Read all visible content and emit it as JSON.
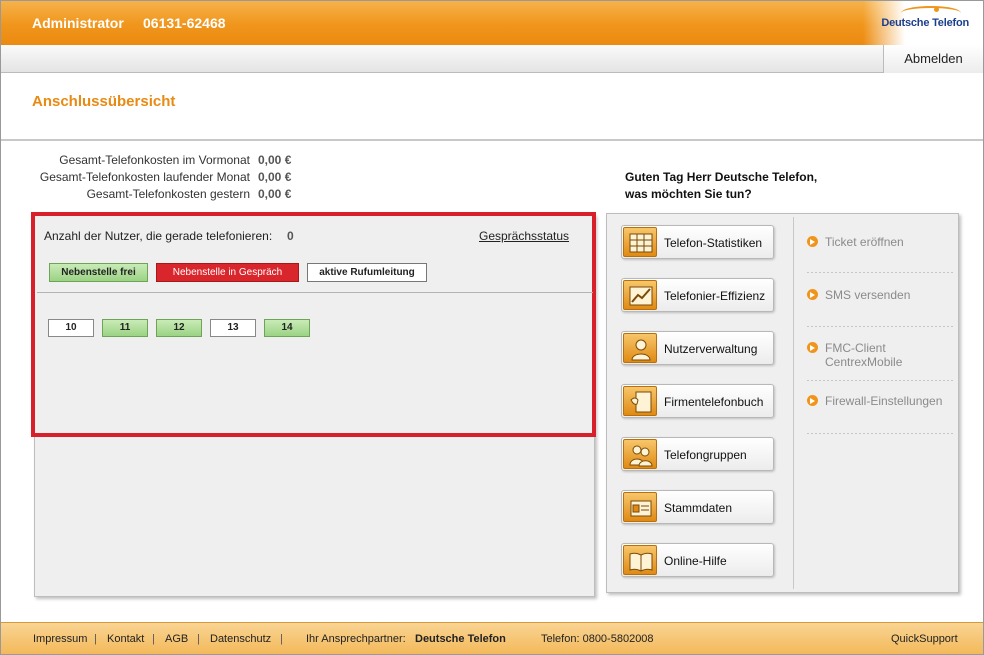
{
  "header": {
    "user": "Administrator",
    "phone": "06131-62468",
    "logo": "Deutsche Telefon",
    "logout": "Abmelden"
  },
  "page": {
    "title": "Anschlussübersicht"
  },
  "costs": [
    {
      "label": "Gesamt-Telefonkosten im Vormonat",
      "value": "0,00 €"
    },
    {
      "label": "Gesamt-Telefonkosten laufender Monat",
      "value": "0,00 €"
    },
    {
      "label": "Gesamt-Telefonkosten gestern",
      "value": "0,00 €"
    }
  ],
  "status": {
    "users_label": "Anzahl der Nutzer, die gerade telefonieren:",
    "users_count": "0",
    "link": "Gesprächsstatus",
    "legend": {
      "free": "Nebenstelle frei",
      "busy": "Nebenstelle in Gespräch",
      "forward": "aktive Rufumleitung"
    },
    "extensions": [
      "10",
      "11",
      "12",
      "13",
      "14"
    ]
  },
  "greeting": {
    "line1": "Guten Tag Herr Deutsche Telefon,",
    "line2": "was möchten Sie tun?"
  },
  "actions": [
    {
      "label": "Telefon-Statistiken",
      "icon": "statistics-icon"
    },
    {
      "label": "Telefonier-Effizienz",
      "icon": "efficiency-icon"
    },
    {
      "label": "Nutzerverwaltung",
      "icon": "user-icon"
    },
    {
      "label": "Firmentelefonbuch",
      "icon": "phonebook-icon"
    },
    {
      "label": "Telefongruppen",
      "icon": "group-icon"
    },
    {
      "label": "Stammdaten",
      "icon": "master-data-icon"
    },
    {
      "label": "Online-Hilfe",
      "icon": "book-icon"
    }
  ],
  "side_links": [
    {
      "label": "Ticket eröffnen"
    },
    {
      "label": "SMS versenden"
    },
    {
      "label": "FMC-Client",
      "label2": "CentrexMobile"
    },
    {
      "label": "Firewall-Einstellungen"
    }
  ],
  "footer": {
    "impressum": "Impressum",
    "kontakt": "Kontakt",
    "agb": "AGB",
    "datenschutz": "Datenschutz",
    "partner_label": "Ihr Ansprechpartner:",
    "partner_name": "Deutsche Telefon",
    "phone": "Telefon: 0800-5802008",
    "quicksupport": "QuickSupport"
  },
  "colors": {
    "accent": "#f0951c",
    "busy": "#d8262c",
    "free": "#9bd384",
    "title": "#e98a12"
  }
}
